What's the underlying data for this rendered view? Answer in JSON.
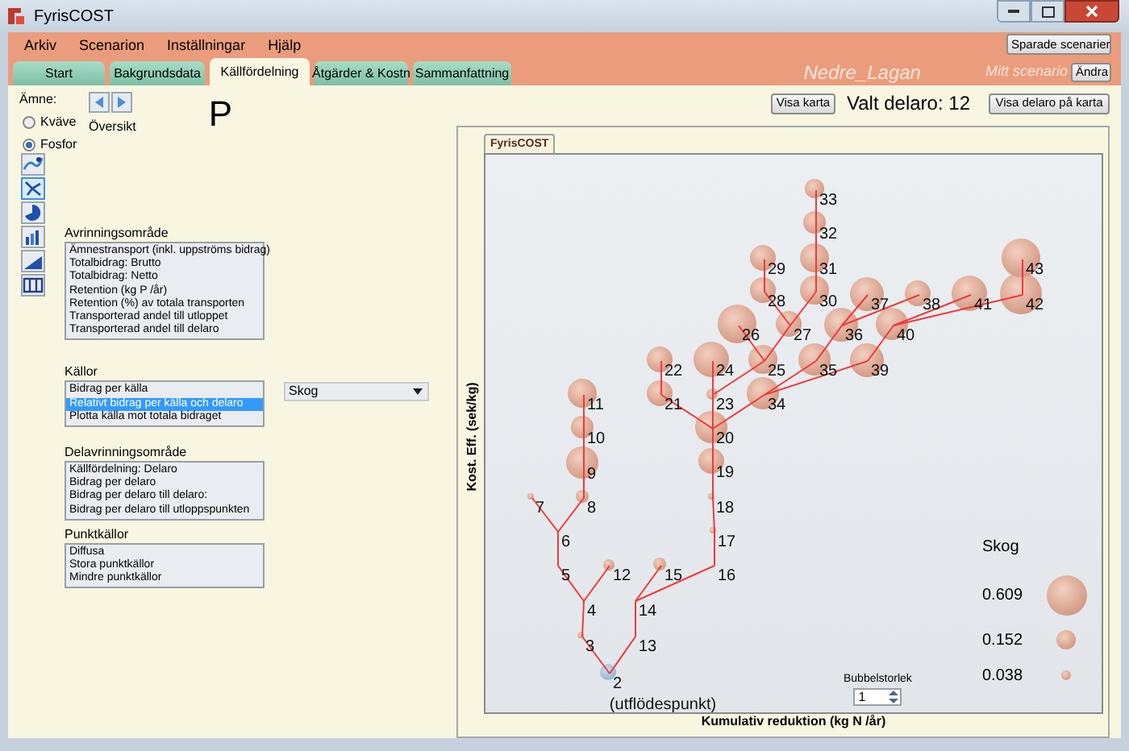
{
  "window": {
    "title": "FyrisCOST"
  },
  "menu": [
    "Arkiv",
    "Scenarion",
    "Inställningar",
    "Hjälp"
  ],
  "tabs": [
    {
      "label": "Start",
      "selected": false
    },
    {
      "label": "Bakgrundsdata",
      "selected": false
    },
    {
      "label": "Källfördelning",
      "selected": true
    },
    {
      "label": "Åtgärder & Kostn",
      "selected": false
    },
    {
      "label": "Sammanfattning",
      "selected": false
    }
  ],
  "header": {
    "saved_button": "Sparade scenarier",
    "area_name": "Nedre_Lagan",
    "scenario_label": "Mitt scenario",
    "change_button": "Ändra"
  },
  "substance": {
    "label": "Ämne:",
    "options": [
      {
        "label": "Kväve",
        "selected": false
      },
      {
        "label": "Fosfor",
        "selected": true
      }
    ],
    "symbol": "P"
  },
  "nav": {
    "label": "Översikt"
  },
  "toolbar": [
    {
      "kind": "map",
      "selected": false
    },
    {
      "kind": "network",
      "selected": true
    },
    {
      "kind": "pie",
      "selected": false
    },
    {
      "kind": "bar",
      "selected": false
    },
    {
      "kind": "area",
      "selected": false
    },
    {
      "kind": "columns",
      "selected": false
    }
  ],
  "lists": [
    {
      "title": "Avrinningsområde",
      "items": [
        {
          "label": "Ämnestransport (inkl. uppströms bidrag)",
          "selected": false
        },
        {
          "label": "Totalbidrag: Brutto",
          "selected": false
        },
        {
          "label": "Totalbidrag: Netto",
          "selected": false
        },
        {
          "label": "Retention (kg P /år)",
          "selected": false
        },
        {
          "label": "Retention (%) av totala transporten",
          "selected": false
        },
        {
          "label": "Transporterad andel till utloppet",
          "selected": false
        },
        {
          "label": "Transporterad andel till delaro",
          "selected": false
        }
      ]
    },
    {
      "title": "Källor",
      "items": [
        {
          "label": "Bidrag per källa",
          "selected": false
        },
        {
          "label": "Relativt bidrag per källa och delaro",
          "selected": true
        },
        {
          "label": "Plotta källa mot totala bidraget",
          "selected": false
        }
      ],
      "dropdown": "Skog"
    },
    {
      "title": "Delavrinningsområde",
      "items": [
        {
          "label": "Källfördelning: Delaro",
          "selected": false
        },
        {
          "label": "Bidrag per delaro",
          "selected": false
        },
        {
          "label": "Bidrag per delaro till delaro:",
          "selected": false
        },
        {
          "label": "Bidrag per delaro till utloppspunkten",
          "selected": false
        }
      ]
    },
    {
      "title": "Punktkällor",
      "items": [
        {
          "label": "Diffusa",
          "selected": false
        },
        {
          "label": "Stora punktkällor",
          "selected": false
        },
        {
          "label": "Mindre punktkällor",
          "selected": false
        }
      ]
    }
  ],
  "top_bar": {
    "map_button": "Visa karta",
    "selected_area": "Valt delaro: 12",
    "show_on_map_button": "Visa delaro på karta"
  },
  "chart": {
    "tab": "FyrisCOST",
    "ylabel": "Kost. Eff. (sek/kg)",
    "xlabel": "Kumulativ reduktion (kg N /år)",
    "outlet_note": "(utflödespunkt)",
    "tree": {
      "label": "2",
      "kind": "outlet",
      "children": [
        {
          "label": "3",
          "kind": "node",
          "children": [
            {
              "label": "4",
              "kind": "node",
              "children": [
                {
                  "label": "5",
                  "kind": "node",
                  "children": [
                    {
                      "label": "6",
                      "kind": "node",
                      "children": [
                        {
                          "label": "7",
                          "kind": "node"
                        },
                        {
                          "label": "8",
                          "kind": "node",
                          "children": [
                            {
                              "label": "9",
                              "kind": "node",
                              "children": [
                                {
                                  "label": "10",
                                  "kind": "node",
                                  "children": [
                                    {
                                      "label": "11",
                                      "kind": "node"
                                    }
                                  ]
                                }
                              ]
                            }
                          ]
                        }
                      ]
                    }
                  ]
                },
                {
                  "label": "12",
                  "kind": "node"
                }
              ]
            }
          ]
        },
        {
          "label": "13",
          "kind": "node",
          "children": [
            {
              "label": "14",
              "kind": "node",
              "children": [
                {
                  "label": "15",
                  "kind": "node"
                },
                {
                  "label": "16",
                  "kind": "node",
                  "children": [
                    {
                      "label": "17",
                      "kind": "node",
                      "children": [
                        {
                          "label": "18",
                          "kind": "node",
                          "children": [
                            {
                              "label": "19",
                              "kind": "node",
                              "children": [
                                {
                                  "label": "20",
                                  "kind": "node",
                                  "children": [
                                    {
                                      "label": "21",
                                      "kind": "node",
                                      "children": [
                                        {
                                          "label": "22",
                                          "kind": "node"
                                        }
                                      ]
                                    },
                                    {
                                      "label": "23",
                                      "kind": "node",
                                      "children": [
                                        {
                                          "label": "24",
                                          "kind": "node"
                                        },
                                        {
                                          "label": "25",
                                          "kind": "node",
                                          "children": [
                                            {
                                              "label": "26",
                                              "kind": "node"
                                            },
                                            {
                                              "label": "27",
                                              "kind": "node",
                                              "children": [
                                                {
                                                  "label": "28",
                                                  "kind": "node",
                                                  "children": [
                                                    {
                                                      "label": "29",
                                                      "kind": "node"
                                                    }
                                                  ]
                                                },
                                                {
                                                  "label": "30",
                                                  "kind": "node",
                                                  "children": [
                                                    {
                                                      "label": "31",
                                                      "kind": "node",
                                                      "children": [
                                                        {
                                                          "label": "32",
                                                          "kind": "node",
                                                          "children": [
                                                            {
                                                              "label": "33",
                                                              "kind": "node"
                                                            }
                                                          ]
                                                        }
                                                      ]
                                                    }
                                                  ]
                                                }
                                              ]
                                            }
                                          ]
                                        }
                                      ]
                                    },
                                    {
                                      "label": "34",
                                      "kind": "node",
                                      "children": [
                                        {
                                          "label": "35",
                                          "kind": "node",
                                          "children": [
                                            {
                                              "label": "36",
                                              "kind": "node",
                                              "children": [
                                                {
                                                  "label": "37",
                                                  "kind": "node"
                                                },
                                                {
                                                  "label": "38",
                                                  "kind": "node"
                                                }
                                              ]
                                            }
                                          ]
                                        },
                                        {
                                          "label": "39",
                                          "kind": "node",
                                          "children": [
                                            {
                                              "label": "40",
                                              "kind": "node",
                                              "children": [
                                                {
                                                  "label": "41",
                                                  "kind": "node"
                                                },
                                                {
                                                  "label": "42",
                                                  "kind": "node",
                                                  "children": [
                                                    {
                                                      "label": "43",
                                                      "kind": "node"
                                                    }
                                                  ]
                                                }
                                              ]
                                            }
                                          ]
                                        }
                                      ]
                                    }
                                  ]
                                }
                              ]
                            }
                          ]
                        }
                      ]
                    }
                  ]
                }
              ]
            }
          ]
        }
      ]
    },
    "legend": {
      "title": "Skog",
      "items": [
        {
          "label": "0.609"
        },
        {
          "label": "0.152"
        },
        {
          "label": "0.038"
        }
      ]
    },
    "bubble_size": {
      "label": "Bubbelstorlek",
      "value": "1"
    }
  }
}
